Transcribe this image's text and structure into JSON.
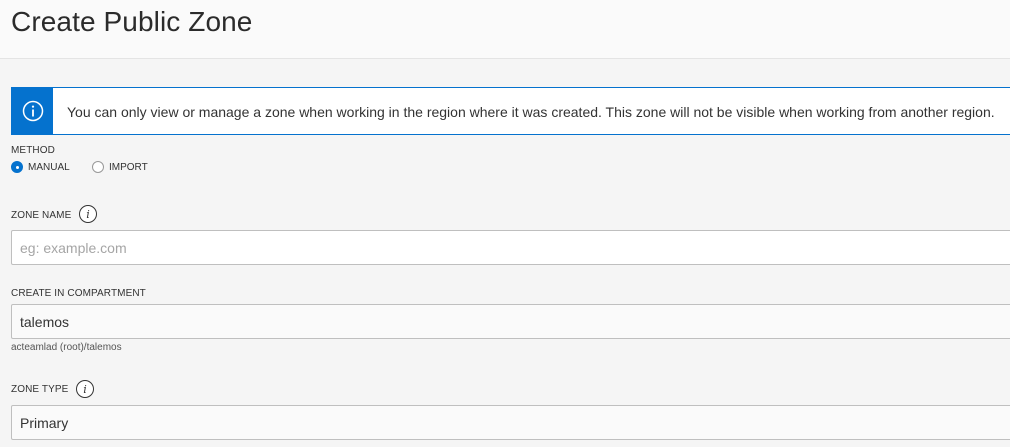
{
  "header": {
    "title": "Create Public Zone"
  },
  "banner": {
    "icon": "info-icon",
    "message": "You can only view or manage a zone when working in the region where it was created. This zone will not be visible when working from another region."
  },
  "method": {
    "label": "METHOD",
    "options": [
      {
        "label": "MANUAL",
        "selected": true
      },
      {
        "label": "IMPORT",
        "selected": false
      }
    ]
  },
  "zone_name": {
    "label": "ZONE NAME",
    "placeholder": "eg: example.com",
    "value": ""
  },
  "compartment": {
    "label": "CREATE IN COMPARTMENT",
    "value": "talemos",
    "path": "acteamlad (root)/talemos"
  },
  "zone_type": {
    "label": "ZONE TYPE",
    "value": "Primary"
  },
  "help_glyph": "i",
  "colors": {
    "accent": "#0572ce",
    "background": "#f5f5f5"
  }
}
